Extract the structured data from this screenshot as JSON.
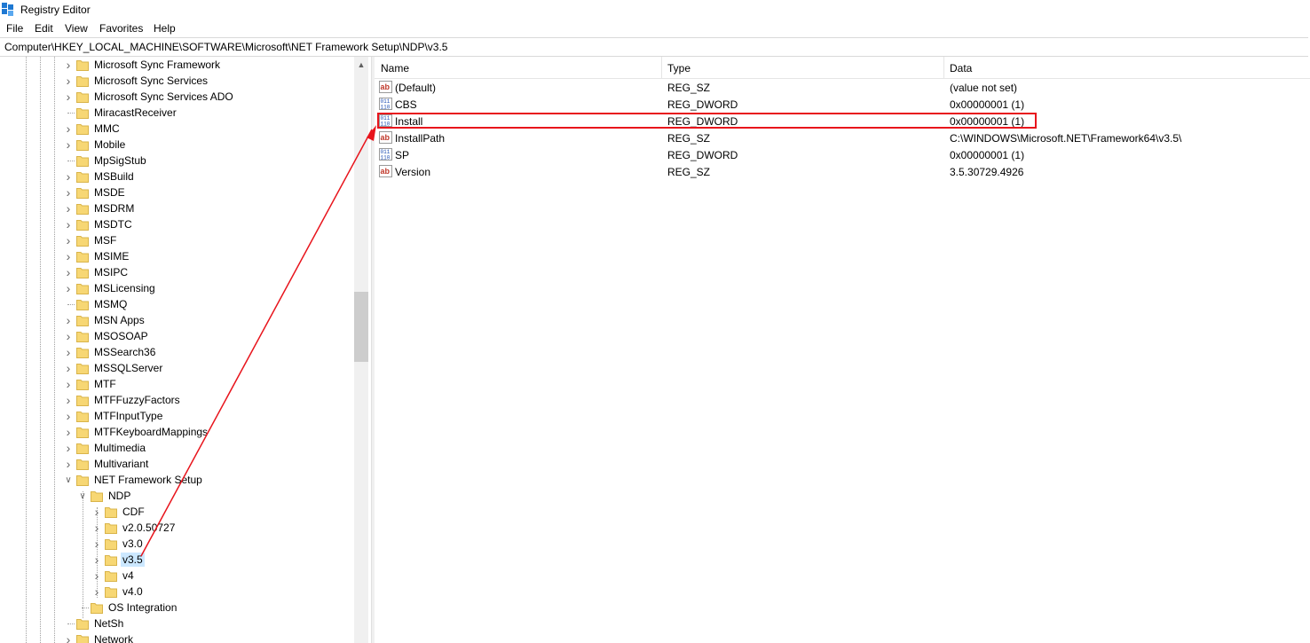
{
  "window": {
    "title": "Registry Editor"
  },
  "menu": [
    "File",
    "Edit",
    "View",
    "Favorites",
    "Help"
  ],
  "address": "Computer\\HKEY_LOCAL_MACHINE\\SOFTWARE\\Microsoft\\NET Framework Setup\\NDP\\v3.5",
  "tree": {
    "items": [
      {
        "label": "Microsoft Sync Framework",
        "expander": "collapsed"
      },
      {
        "label": "Microsoft Sync Services",
        "expander": "collapsed"
      },
      {
        "label": "Microsoft Sync Services ADO",
        "expander": "collapsed"
      },
      {
        "label": "MiracastReceiver",
        "expander": "none"
      },
      {
        "label": "MMC",
        "expander": "collapsed"
      },
      {
        "label": "Mobile",
        "expander": "collapsed"
      },
      {
        "label": "MpSigStub",
        "expander": "none"
      },
      {
        "label": "MSBuild",
        "expander": "collapsed"
      },
      {
        "label": "MSDE",
        "expander": "collapsed"
      },
      {
        "label": "MSDRM",
        "expander": "collapsed"
      },
      {
        "label": "MSDTC",
        "expander": "collapsed"
      },
      {
        "label": "MSF",
        "expander": "collapsed"
      },
      {
        "label": "MSIME",
        "expander": "collapsed"
      },
      {
        "label": "MSIPC",
        "expander": "collapsed"
      },
      {
        "label": "MSLicensing",
        "expander": "collapsed"
      },
      {
        "label": "MSMQ",
        "expander": "none"
      },
      {
        "label": "MSN Apps",
        "expander": "collapsed"
      },
      {
        "label": "MSOSOAP",
        "expander": "collapsed"
      },
      {
        "label": "MSSearch36",
        "expander": "collapsed"
      },
      {
        "label": "MSSQLServer",
        "expander": "collapsed"
      },
      {
        "label": "MTF",
        "expander": "collapsed"
      },
      {
        "label": "MTFFuzzyFactors",
        "expander": "collapsed"
      },
      {
        "label": "MTFInputType",
        "expander": "collapsed"
      },
      {
        "label": "MTFKeyboardMappings",
        "expander": "collapsed"
      },
      {
        "label": "Multimedia",
        "expander": "collapsed"
      },
      {
        "label": "Multivariant",
        "expander": "collapsed"
      },
      {
        "label": "NET Framework Setup",
        "expander": "expanded"
      },
      {
        "label": "NDP",
        "expander": "expanded"
      },
      {
        "label": "CDF",
        "expander": "collapsed"
      },
      {
        "label": "v2.0.50727",
        "expander": "collapsed"
      },
      {
        "label": "v3.0",
        "expander": "collapsed"
      },
      {
        "label": "v3.5",
        "expander": "collapsed",
        "selected": true
      },
      {
        "label": "v4",
        "expander": "collapsed"
      },
      {
        "label": "v4.0",
        "expander": "collapsed"
      },
      {
        "label": "OS Integration",
        "expander": "none"
      },
      {
        "label": "NetSh",
        "expander": "none"
      },
      {
        "label": "Network",
        "expander": "collapsed"
      }
    ]
  },
  "list": {
    "headers": {
      "name": "Name",
      "type": "Type",
      "data": "Data"
    },
    "rows": [
      {
        "name": "(Default)",
        "type": "REG_SZ",
        "data": "(value not set)",
        "icon": "string-value-icon"
      },
      {
        "name": "CBS",
        "type": "REG_DWORD",
        "data": "0x00000001 (1)",
        "icon": "binary-value-icon"
      },
      {
        "name": "Install",
        "type": "REG_DWORD",
        "data": "0x00000001 (1)",
        "icon": "binary-value-icon",
        "highlighted": true
      },
      {
        "name": "InstallPath",
        "type": "REG_SZ",
        "data": "C:\\WINDOWS\\Microsoft.NET\\Framework64\\v3.5\\",
        "icon": "string-value-icon"
      },
      {
        "name": "SP",
        "type": "REG_DWORD",
        "data": "0x00000001 (1)",
        "icon": "binary-value-icon"
      },
      {
        "name": "Version",
        "type": "REG_SZ",
        "data": "3.5.30729.4926",
        "icon": "string-value-icon"
      }
    ]
  },
  "colors": {
    "annotation": "#e8141c",
    "selection": "#cce8ff",
    "folder": "#f7d774"
  }
}
